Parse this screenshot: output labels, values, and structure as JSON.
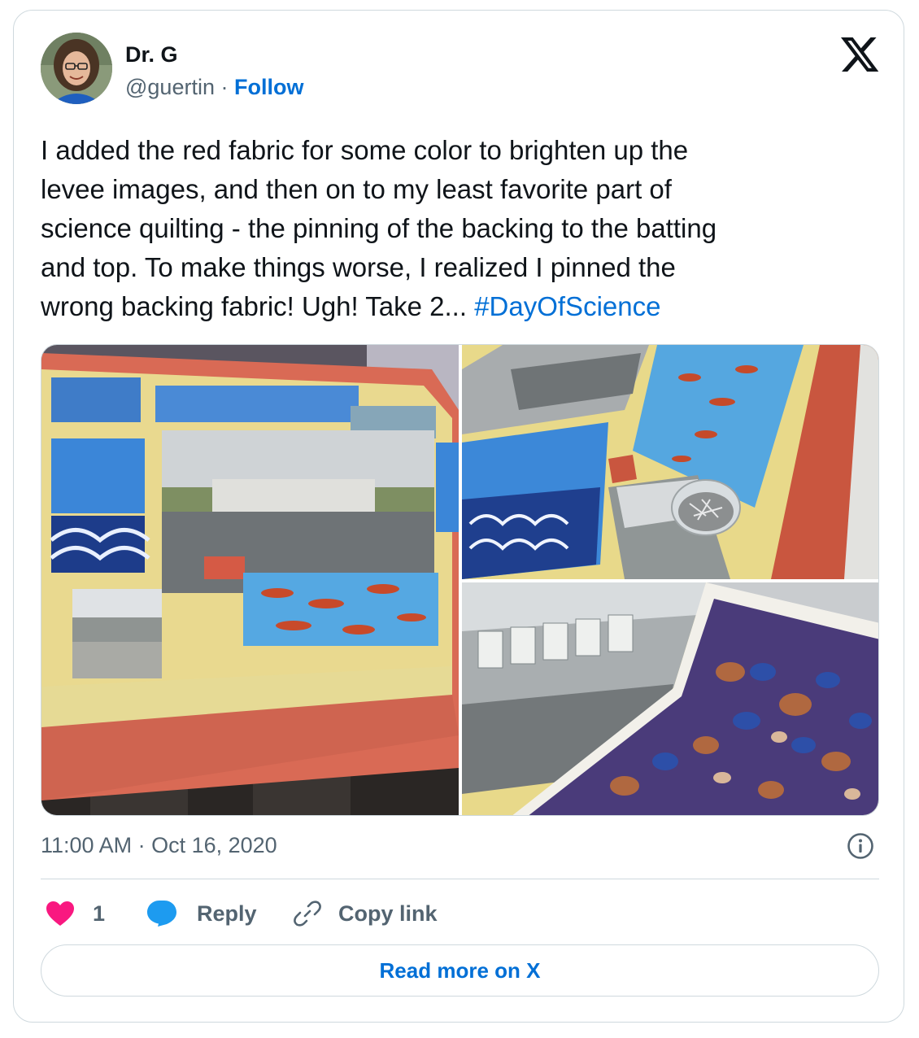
{
  "author": {
    "display_name": "Dr. G",
    "handle": "@guertin",
    "separator": "·",
    "follow_label": "Follow"
  },
  "tweet": {
    "lines": [
      "I added the red fabric for some color to brighten up the",
      "levee images, and then on to my least favorite part of",
      "science quilting - the pinning of the backing to the batting",
      "and top. To make things worse, I realized I pinned the"
    ],
    "last_line_text": "wrong backing fabric! Ugh! Take 2... ",
    "hashtag": "#DayOfScience"
  },
  "media": [
    {
      "icon": "photo-quilt-top"
    },
    {
      "icon": "photo-quilt-pins"
    },
    {
      "icon": "photo-backing-fabric"
    }
  ],
  "timestamp": {
    "time": "11:00 AM",
    "separator": " · ",
    "date": "Oct 16, 2020"
  },
  "actions": {
    "like_count": "1",
    "reply_label": "Reply",
    "copy_link_label": "Copy link"
  },
  "read_more_label": "Read more on X",
  "colors": {
    "link": "#006fd6",
    "secondary_text": "#536471",
    "border": "#cfd9de",
    "heart": "#f91880",
    "reply_bubble": "#1d9bf0"
  }
}
